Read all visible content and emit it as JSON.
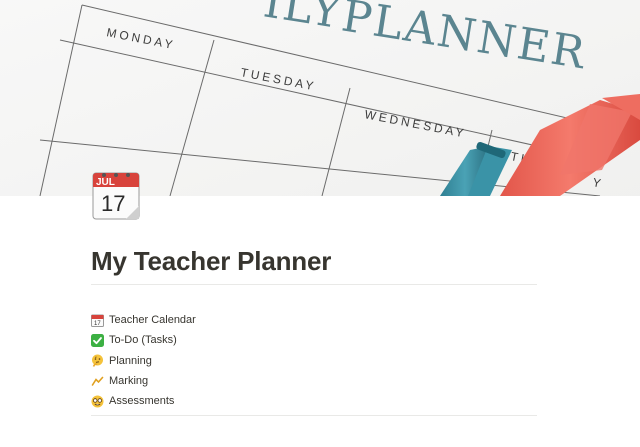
{
  "cover": {
    "planner_heading": "PLANNER",
    "heading_prefix": "ILY",
    "days": [
      "MONDAY",
      "TUESDAY",
      "WEDNESDAY",
      "TH",
      "Y"
    ]
  },
  "icon": {
    "name": "calendar-icon",
    "month": "JUL",
    "day": "17"
  },
  "page": {
    "title": "My Teacher Planner"
  },
  "links": [
    {
      "label": "Teacher Calendar",
      "icon": "calendar-icon"
    },
    {
      "label": "To-Do (Tasks)",
      "icon": "check-mark-icon"
    },
    {
      "label": "Planning",
      "icon": "thinking-face-icon"
    },
    {
      "label": "Marking",
      "icon": "marker-icon"
    },
    {
      "label": "Assessments",
      "icon": "nerd-face-icon"
    }
  ]
}
